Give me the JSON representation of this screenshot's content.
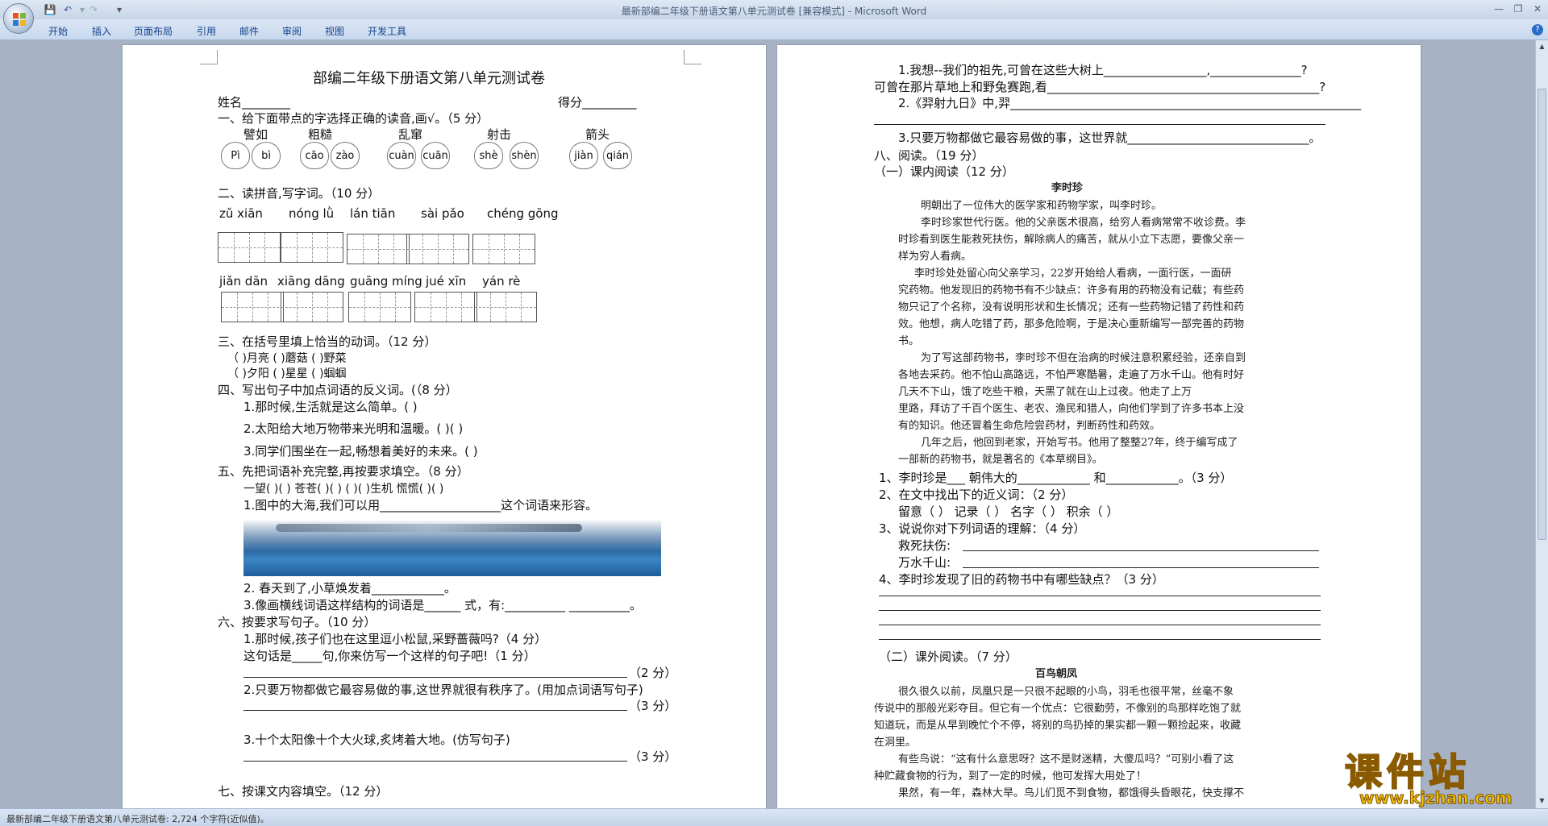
{
  "window": {
    "title": "最新部编二年级下册语文第八单元测试卷 [兼容模式] - Microsoft Word",
    "menu_tabs": [
      "开始",
      "插入",
      "页面布局",
      "引用",
      "邮件",
      "审阅",
      "视图",
      "开发工具"
    ]
  },
  "statusbar": {
    "text": "最新部编二年级下册语文第八单元测试卷: 2,724 个字符(近似值)。"
  },
  "watermark": {
    "brand": "课件站",
    "url": "www.kjzhan.com"
  },
  "page1": {
    "title": "部编二年级下册语文第八单元测试卷",
    "name_label": "姓名________",
    "score_label": "得分_________",
    "q1_title": "一、给下面带点的字选择正确的读音,画√。（5 分）",
    "q1_words": [
      "譬如",
      "粗糙",
      "乱窜",
      "射击",
      "箭头"
    ],
    "q1_pinyin": [
      "Pì",
      "bì",
      "cāo",
      "zào",
      "cuàn",
      "cuān",
      "shè",
      "shèn",
      "jiàn",
      "qián"
    ],
    "q2_title": "二、读拼音,写字词。（10 分）",
    "q2_row1": [
      "zǔ  xiān",
      "nóng  lǜ",
      "lán  tiān",
      "sài pǎo",
      "chéng gōng"
    ],
    "q2_row2": [
      "jiǎn dān",
      "xiāng dāng",
      "guāng míng",
      "jué   xīn",
      "yán   rè"
    ],
    "q3_title": "三、在括号里填上恰当的动词。（12 分）",
    "q3_line1": "（           )月亮        (            )蘑菇         (            )野菜",
    "q3_line2": "（           )夕阳        (            )星星         (            )蝈蝈",
    "q4_title": "四、写出句子中加点词语的反义词。(（8 分）",
    "q4_1": "1.那时候,生活就是这么简单。(                  )",
    "q4_2": "2.太阳给大地万物带来光明和温暖。(                  )(                  )",
    "q4_3": "3.同学们围坐在一起,畅想着美好的未来。(                  )",
    "q5_title": "五、先把词语补充完整,再按要求填空。（8 分）",
    "q5_words": "一望(      )(      )     苍苍(      )(      )     (      )(      )生机    慌慌(      )(      )",
    "q5_1": "1.图中的大海,我们可以用____________________这个词语来形容。",
    "q5_2": "2.   春天到了,小草焕发着____________。",
    "q5_3": "3.像画横线词语这样结构的词语是______ 式，有:__________  __________。",
    "q6_title": "六、按要求写句子。（10 分）",
    "q6_1": "1.那时候,孩子们也在这里逗小松鼠,采野蔷薇吗?（4 分）",
    "q6_1b": "这句话是_____句,你来仿写一个这样的句子吧!（1 分）",
    "q6_1c": "（2 分）",
    "q6_2": "2.只要万物都做它最容易做的事,这世界就很有秩序了。(用加点词语写句子)",
    "q6_2c": "（3 分）",
    "q6_3": "3.十个太阳像十个大火球,炙烤着大地。(仿写句子)",
    "q6_3c": "（3 分）",
    "q7_title": "七、按课文内容填空。（12 分）"
  },
  "page2": {
    "l1": "1.我想--我们的祖先,可曾在这些大树上_________________,_______________?",
    "l2": "可曾在那片草地上和野兔赛跑,看_____________________________________________?",
    "l3": "2.《羿射九日》中,羿__________________________________________________________",
    "l5": "3.只要万物都做它最容易做的事，这世界就______________________________。",
    "q8_title": "八、阅读。（19 分）",
    "q8_1_title": "（一）课内阅读（12 分）",
    "story1_title": "李时珍",
    "story1": [
      "明朝出了一位伟大的医学家和药物学家，叫李时珍。",
      "李时珍家世代行医。他的父亲医术很高，给穷人看病常常不收诊费。李",
      "时珍看到医生能救死扶伤，解除病人的痛苦，就从小立下志愿，要像父亲一",
      "样为穷人看病。",
      "李时珍处处留心向父亲学习，22岁开始给人看病，一面行医，一面研",
      "究药物。他发现旧的药物书有不少缺点：许多有用的药物没有记载；有些药",
      "物只记了个名称，没有说明形状和生长情况；还有一些药物记错了药性和药",
      "效。他想，病人吃错了药，那多危险啊，于是决心重新编写一部完善的药物",
      "书。",
      "为了写这部药物书，李时珍不但在治病的时候注意积累经验，还亲自到",
      "各地去采药。他不怕山高路远，不怕严寒酷暑，走遍了万水千山。他有时好",
      "几天不下山，饿了吃些干粮，天黑了就在山上过夜。他走了上万",
      "里路，拜访了千百个医生、老农、渔民和猎人，向他们学到了许多书本上没",
      "有的知识。他还冒着生命危险尝药材，判断药性和药效。",
      "几年之后，他回到老家，开始写书。他用了整整27年，终于编写成了",
      "一部新的药物书，就是著名的《本草纲目》。"
    ],
    "r1": "1、李时珍是___   朝伟大的____________  和____________。（3 分）",
    "r2": "2、在文中找出下的近义词：（2 分）",
    "r2b": "留意（          ）      记录（          ）      名字（          ）      积余（          ）",
    "r3": "3、说说你对下列词语的理解：（4 分）",
    "r3a": "救死扶伤:",
    "r3b": "万水千山:",
    "r4": "4、李时珍发现了旧的药物书中有哪些缺点？（3 分）",
    "q8_2_title": "（二）课外阅读。（7 分）",
    "story2_title": "百鸟朝凤",
    "story2": [
      "很久很久以前，凤凰只是一只很不起眼的小鸟，羽毛也很平常，丝毫不象",
      "传说中的那般光彩夺目。但它有一个优点：它很勤劳，不像别的鸟那样吃饱了就",
      "知道玩，而是从早到晚忙个不停，将别的鸟扔掉的果实都一颗一颗捡起来，收藏",
      "在洞里。",
      "有些鸟说：“这有什么意思呀？这不是财迷精，大傻瓜吗？”可别小看了这",
      "种贮藏食物的行为，到了一定的时候，他可发挥大用处了！",
      "果然，有一年，森林大旱。鸟儿们觅不到食物，都饿得头昏眼花，快支撑不"
    ]
  }
}
